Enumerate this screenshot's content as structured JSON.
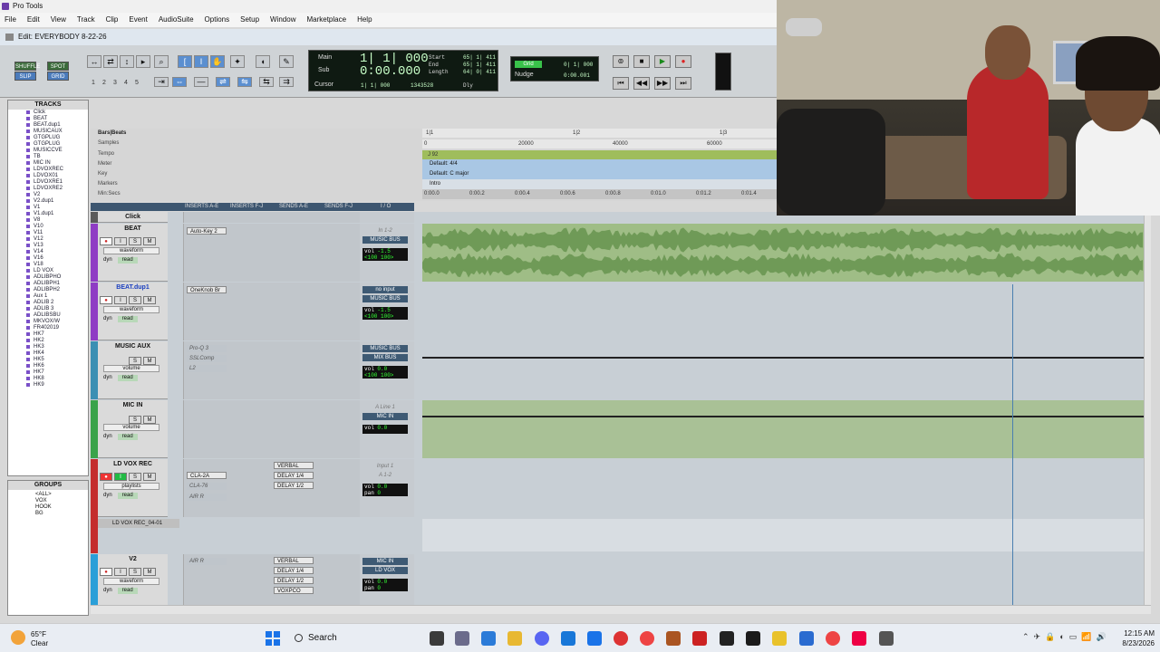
{
  "window": {
    "title": "Pro Tools",
    "edit_title": "Edit: EVERYBODY 8-22-26"
  },
  "menu": [
    "File",
    "Edit",
    "View",
    "Track",
    "Clip",
    "Event",
    "AudioSuite",
    "Options",
    "Setup",
    "Window",
    "Marketplace",
    "Help"
  ],
  "toolbar": {
    "shuffle": "SHUFFLE",
    "spot": "SPOT",
    "slip": "SLIP",
    "grid": "GRID",
    "counter": {
      "main_label": "Main",
      "sub_label": "Sub",
      "cursor_label": "Cursor",
      "main_value": "1| 1| 000",
      "sub_value": "0:00.000",
      "start_label": "Start",
      "end_label": "End",
      "length_label": "Length",
      "start": "65| 1| 411",
      "end": "65| 1| 411",
      "length": "64| 0| 411",
      "cursor_value": "1| 1| 000",
      "samples": "1343528",
      "dly": "Dly"
    },
    "grid_label": "Grid",
    "grid_value": "0| 1| 000",
    "nudge_label": "Nudge",
    "nudge_value": "0:00.001",
    "tool_numbers": [
      "1",
      "2",
      "3",
      "4",
      "5"
    ]
  },
  "tracks_panel": {
    "title": "TRACKS",
    "items": [
      "Click",
      "BEAT",
      "BEAT.dup1",
      "MUSICAUX",
      "GTGPLUG",
      "GTGPLUG",
      "MUSICCVE",
      "TB",
      "MIC IN",
      "LDVOXREC",
      "LDVOX01",
      "LDVOXRE1",
      "LDVOXRE2",
      "V2",
      "V2.dup1",
      "V1",
      "V1.dup1",
      "V8",
      "V10",
      "V11",
      "V12",
      "V13",
      "V14",
      "V16",
      "V18",
      "LD VOX",
      "ADLIBPHO",
      "ADLIBPH1",
      "ADLIBPH2",
      "Aux 1",
      "ADLIB 2",
      "ADLIB 3",
      "ADLIBSBU",
      "MKVOX/W",
      "FR402019",
      "HK7",
      "HK2",
      "HK3",
      "HK4",
      "HK5",
      "HK6",
      "HK7",
      "HK8",
      "HK9"
    ]
  },
  "groups_panel": {
    "title": "GROUPS",
    "items": [
      "<ALL>",
      "VOX",
      "HOOK",
      "BG"
    ]
  },
  "rulers": {
    "labels": [
      "Bars|Beats",
      "Samples",
      "Tempo",
      "Meter",
      "Key",
      "Markers",
      "Min:Secs"
    ],
    "bars": [
      "1|1",
      "1|2",
      "1|3"
    ],
    "samples": [
      "0",
      "20000",
      "40000",
      "60000"
    ],
    "tempo": "J 92",
    "meter": "Default: 4/4",
    "key": "Default: C major",
    "markers": "Intro",
    "minsecs": [
      "0:00.0",
      "0:00.2",
      "0:00.4",
      "0:00.6",
      "0:00.8",
      "0:01.0",
      "0:01.2",
      "0:01.4"
    ]
  },
  "mixer_header": {
    "inserts_ae": "INSERTS A-E",
    "inserts_fj": "INSERTS F-J",
    "sends_ae": "SENDS A-E",
    "sends_fj": "SENDS F-J",
    "io": "I / O"
  },
  "tracks": [
    {
      "name": "Click"
    },
    {
      "name": "BEAT",
      "view": "waveform",
      "auto": "read",
      "insert1": "Auto-Key 2",
      "in": "In 1-2",
      "out": "MUSIC BUS",
      "vol": "-1.5",
      "pan": "<100  100>"
    },
    {
      "name": "BEAT.dup1",
      "view": "waveform",
      "auto": "read",
      "insert1": "OneKnob Br",
      "in": "no input",
      "out": "MUSIC BUS",
      "vol": "-1.5",
      "pan": "<100  100>"
    },
    {
      "name": "MUSIC AUX",
      "view": "volume",
      "auto": "read",
      "insert1": "Pro-Q 3",
      "insert2": "SSLComp",
      "insert3": "L2",
      "in": "MUSIC BUS",
      "out": "MIX BUS",
      "vol": "0.0",
      "pan": "<100  100>"
    },
    {
      "name": "MIC IN",
      "view": "volume",
      "auto": "read",
      "in": "A Line 1",
      "out": "MIC IN",
      "vol": "0.0"
    },
    {
      "name": "LD VOX REC",
      "view": "playlists",
      "auto": "read",
      "insert1": "CLA-2A",
      "insert2": "CLA-76",
      "insert3": "AIR R",
      "send1": "VERBAL",
      "send2": "DELAY 1/4",
      "send3": "DELAY 1/2",
      "in": "Input 1",
      "out": "A 1-2",
      "vol": "0.0",
      "pan": "0",
      "playlist": "LD VOX REC_04-01"
    },
    {
      "name": "V2",
      "view": "waveform",
      "auto": "read",
      "insert1": "AIR R",
      "send1": "VERBAL",
      "send2": "DELAY 1/4",
      "send3": "DELAY 1/2",
      "send4": "VOXPCO",
      "in": "MIC IN",
      "out": "LD VOX",
      "vol": "0.0",
      "pan": "0"
    }
  ],
  "taskbar": {
    "temp": "65°F",
    "condition": "Clear",
    "search": "Search",
    "time": "12:15 AM",
    "date": "8/23/2026"
  },
  "colors": {
    "accent_purple": "#7a50c8",
    "beat_purple": "#8f3cc4",
    "green_wave": "#9fbd86",
    "record_red": "#e33333"
  }
}
